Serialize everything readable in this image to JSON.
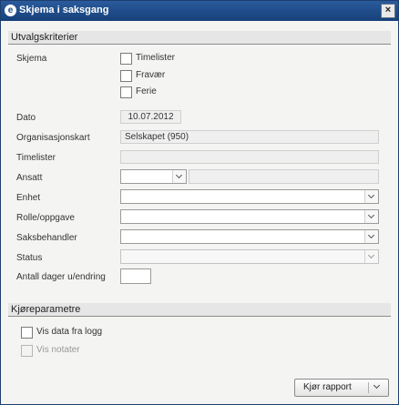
{
  "window": {
    "title": "Skjema i saksgang",
    "close_glyph": "×",
    "app_icon_glyph": "e"
  },
  "selection": {
    "header": "Utvalgskriterier",
    "skjema_label": "Skjema",
    "skjema_options": [
      "Timelister",
      "Fravær",
      "Ferie"
    ],
    "dato_label": "Dato",
    "dato_value": "10.07.2012",
    "org_label": "Organisasjonskart",
    "org_value": "Selskapet (950)",
    "timelister_label": "Timelister",
    "ansatt_label": "Ansatt",
    "enhet_label": "Enhet",
    "rolle_label": "Rolle/oppgave",
    "saksbehandler_label": "Saksbehandler",
    "status_label": "Status",
    "antall_label": "Antall dager u/endring",
    "antall_value": ""
  },
  "run_params": {
    "header": "Kjøreparametre",
    "vis_data_label": "Vis data fra logg",
    "vis_notater_label": "Vis notater"
  },
  "footer": {
    "run_button_label": "Kjør rapport"
  }
}
